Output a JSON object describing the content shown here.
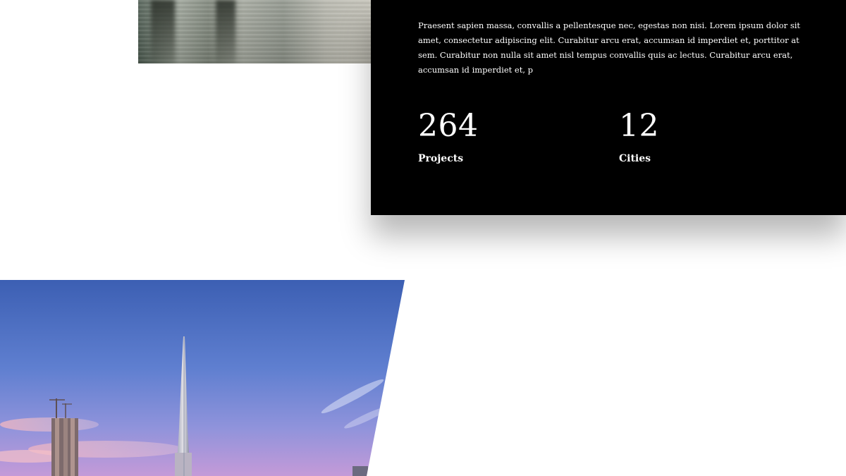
{
  "info_card": {
    "body_text": "Praesent sapien massa, convallis a pellentesque nec, egestas non nisi. Lorem ipsum dolor sit amet, consectetur adipiscing elit. Curabitur arcu erat, accumsan id imperdiet et, porttitor at sem. Curabitur non nulla sit amet nisl tempus convallis quis ac lectus. Curabitur arcu erat, accumsan id imperdiet et, p",
    "stats": [
      {
        "value": "264",
        "label": "Projects"
      },
      {
        "value": "12",
        "label": "Cities"
      }
    ]
  },
  "colors": {
    "card_background": "#000000",
    "page_background": "#ffffff",
    "card_text": "#ffffff"
  }
}
